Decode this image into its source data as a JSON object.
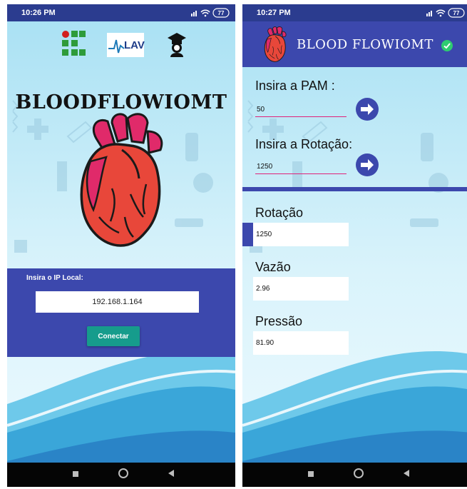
{
  "screens": [
    {
      "status_time": "10:26 PM",
      "battery": "77",
      "logos": [
        "institute-logo",
        "lav-logo",
        "graduate-logo"
      ],
      "lav_logo_text": "LAV",
      "app_title": "BLOODFLOWIOMT",
      "ip_label": "Insira o IP Local:",
      "ip_value": "192.168.1.164",
      "connect_label": "Conectar"
    },
    {
      "status_time": "10:27 PM",
      "battery": "77",
      "app_title": "BLOOD FLOWIOMT",
      "connected_icon": "check-circle-icon",
      "pam_label": "Insira a PAM :",
      "pam_value": "50",
      "rotacao_input_label": "Insira a Rotação:",
      "rotacao_input_value": "1250",
      "readings": [
        {
          "label": "Rotação",
          "value": "1250"
        },
        {
          "label": "Vazão",
          "value": "2.96"
        },
        {
          "label": "Pressão",
          "value": "81.90"
        }
      ]
    }
  ],
  "colors": {
    "primary": "#3c48ad",
    "status_bar": "#2b3c8f",
    "accent_button": "#169c8c",
    "input_underline": "#e0227a",
    "heart_red": "#e8473a",
    "heart_pink": "#e02a6a"
  }
}
